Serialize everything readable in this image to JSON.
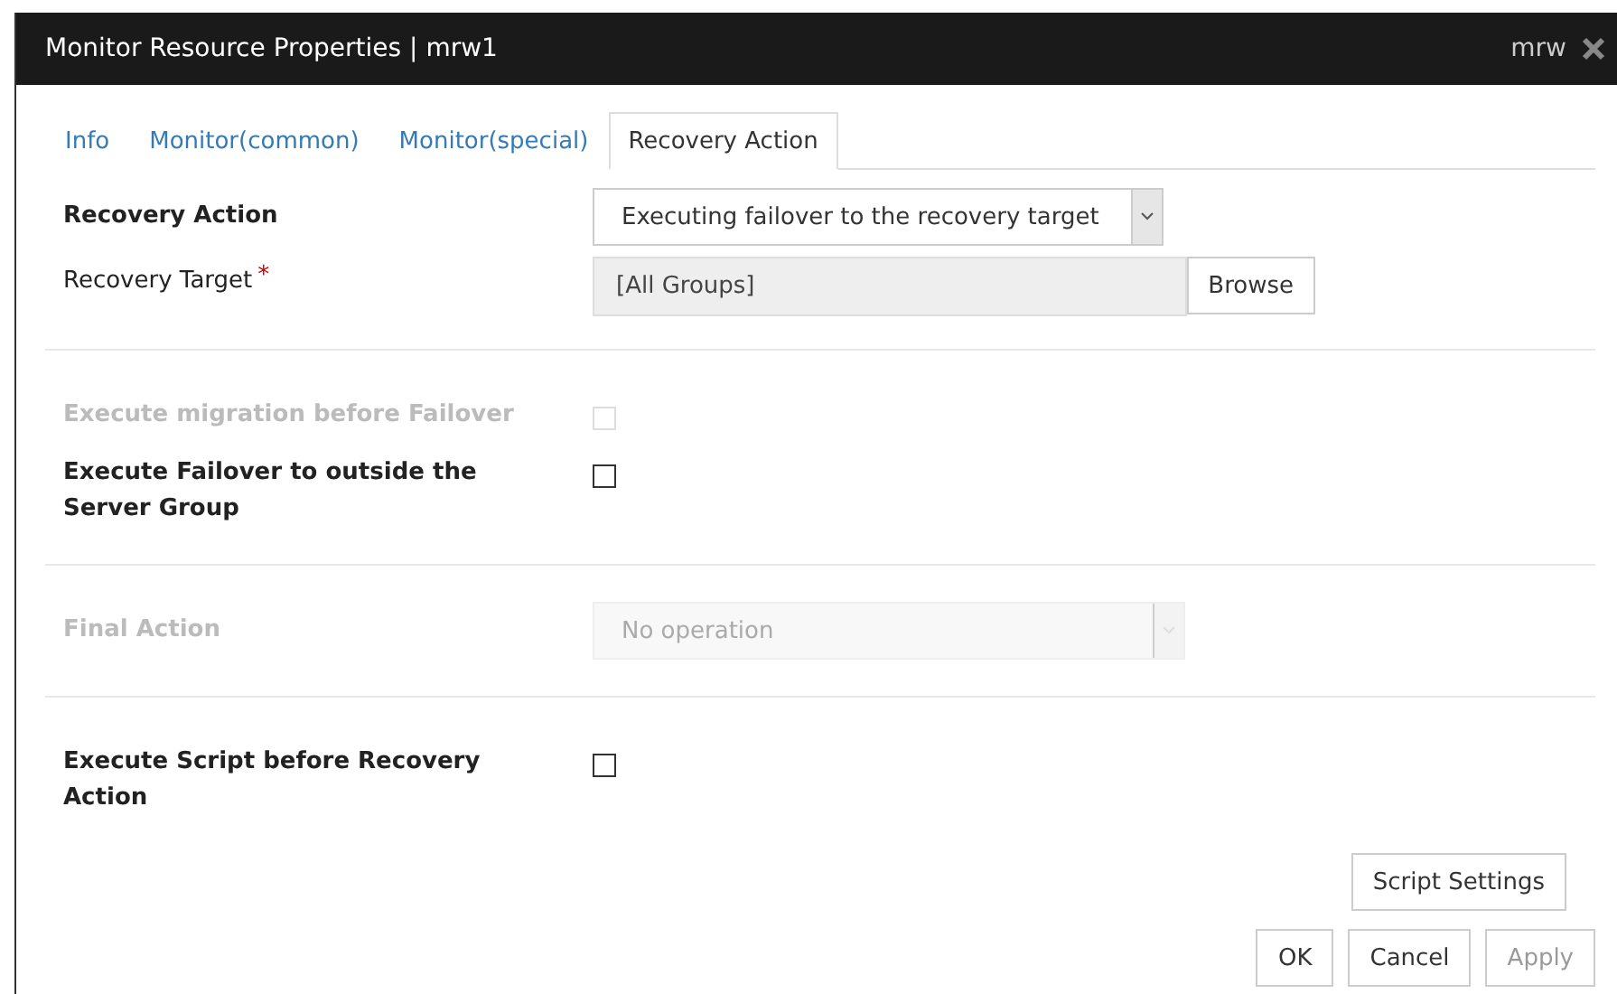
{
  "window": {
    "title": "Monitor Resource Properties | mrw1",
    "user": "mrw"
  },
  "tabs": [
    {
      "label": "Info",
      "selected": false
    },
    {
      "label": "Monitor(common)",
      "selected": false
    },
    {
      "label": "Monitor(special)",
      "selected": false
    },
    {
      "label": "Recovery Action",
      "selected": true
    }
  ],
  "sections": [
    {
      "rows": [
        {
          "kind": "select",
          "label": "Recovery Action",
          "bold": true,
          "value": "Executing failover to the recovery target",
          "disabled": false
        },
        {
          "kind": "browse",
          "label": "Recovery Target",
          "required_mark": "*",
          "bold": false,
          "value": "[All Groups]",
          "button": "Browse",
          "disabled": false
        }
      ]
    },
    {
      "rows": [
        {
          "kind": "checkbox",
          "label": "Execute migration before Failover",
          "bold": true,
          "checked": false,
          "disabled": true
        },
        {
          "kind": "checkbox",
          "label": "Execute Failover to outside the Server Group",
          "bold": true,
          "checked": false,
          "disabled": false
        }
      ]
    },
    {
      "rows": [
        {
          "kind": "select",
          "label": "Final Action",
          "bold": true,
          "value": "No operation",
          "disabled": true
        }
      ]
    },
    {
      "rows": [
        {
          "kind": "checkbox",
          "label": "Execute Script before Recovery Action",
          "bold": true,
          "checked": false,
          "disabled": false
        }
      ]
    }
  ],
  "script_button": {
    "label": "Script Settings",
    "disabled": false
  },
  "buttons": [
    {
      "label": "OK",
      "disabled": false
    },
    {
      "label": "Cancel",
      "disabled": false
    },
    {
      "label": "Apply",
      "disabled": true
    }
  ]
}
